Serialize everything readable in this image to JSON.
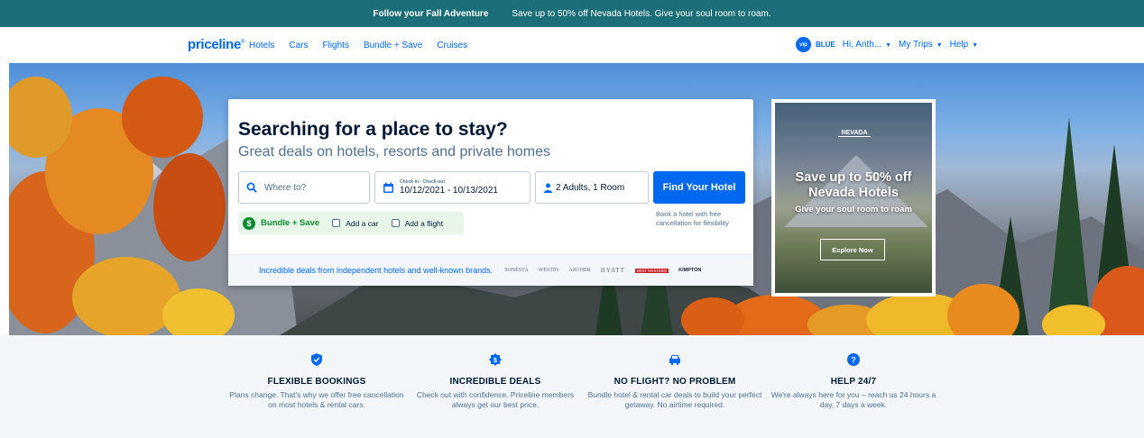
{
  "promo": {
    "headline": "Follow your Fall Adventure",
    "text": "Save up to 50% off Nevada Hotels. Give your soul room to roam."
  },
  "header": {
    "logo": "priceline",
    "nav": [
      "Hotels",
      "Cars",
      "Flights",
      "Bundle + Save",
      "Cruises"
    ],
    "vip_badge": "vip",
    "tier": "BLUE",
    "user": "Hi, Anth...",
    "my_trips": "My Trips",
    "help": "Help"
  },
  "search": {
    "title": "Searching for a place to stay?",
    "subtitle": "Great deals on hotels, resorts and private homes",
    "where_placeholder": "Where to?",
    "dates_label": "Check-in - Check-out",
    "dates_value": "10/12/2021 - 10/13/2021",
    "guests": "2 Adults, 1 Room",
    "find_button": "Find Your Hotel",
    "cancel_note": "Book a hotel with free cancellation for flexibility",
    "bundle_label": "Bundle + Save",
    "add_car": "Add a car",
    "add_flight": "Add a flight",
    "deals_text": "Incredible deals from independent hotels and well-known brands.",
    "brands": [
      "SONESTA",
      "WESTIN",
      "ARCHER",
      "HYATT",
      "BEST WESTERN",
      "KIMPTON"
    ]
  },
  "ad": {
    "badge": "NEVADA",
    "title": "Save up to 50% off Nevada Hotels",
    "subtitle": "Give your soul room to roam",
    "button": "Explore Now"
  },
  "features": [
    {
      "title": "FLEXIBLE BOOKINGS",
      "text": "Plans change. That's why we offer free cancellation on most hotels & rental cars.",
      "icon": "shield-check-icon"
    },
    {
      "title": "INCREDIBLE DEALS",
      "text": "Check out with confidence. Priceline members always get our best price.",
      "icon": "dollar-badge-icon"
    },
    {
      "title": "NO FLIGHT? NO PROBLEM",
      "text": "Bundle hotel & rental car deals to build your perfect getaway. No airtime required.",
      "icon": "car-icon"
    },
    {
      "title": "HELP 24/7",
      "text": "We're always here for you – reach us 24 hours a day, 7 days a week.",
      "icon": "question-circle-icon"
    }
  ],
  "colors": {
    "brand": "#0068ef",
    "promo_bar": "#1c6e78",
    "bundle_green": "#0a8a30"
  }
}
